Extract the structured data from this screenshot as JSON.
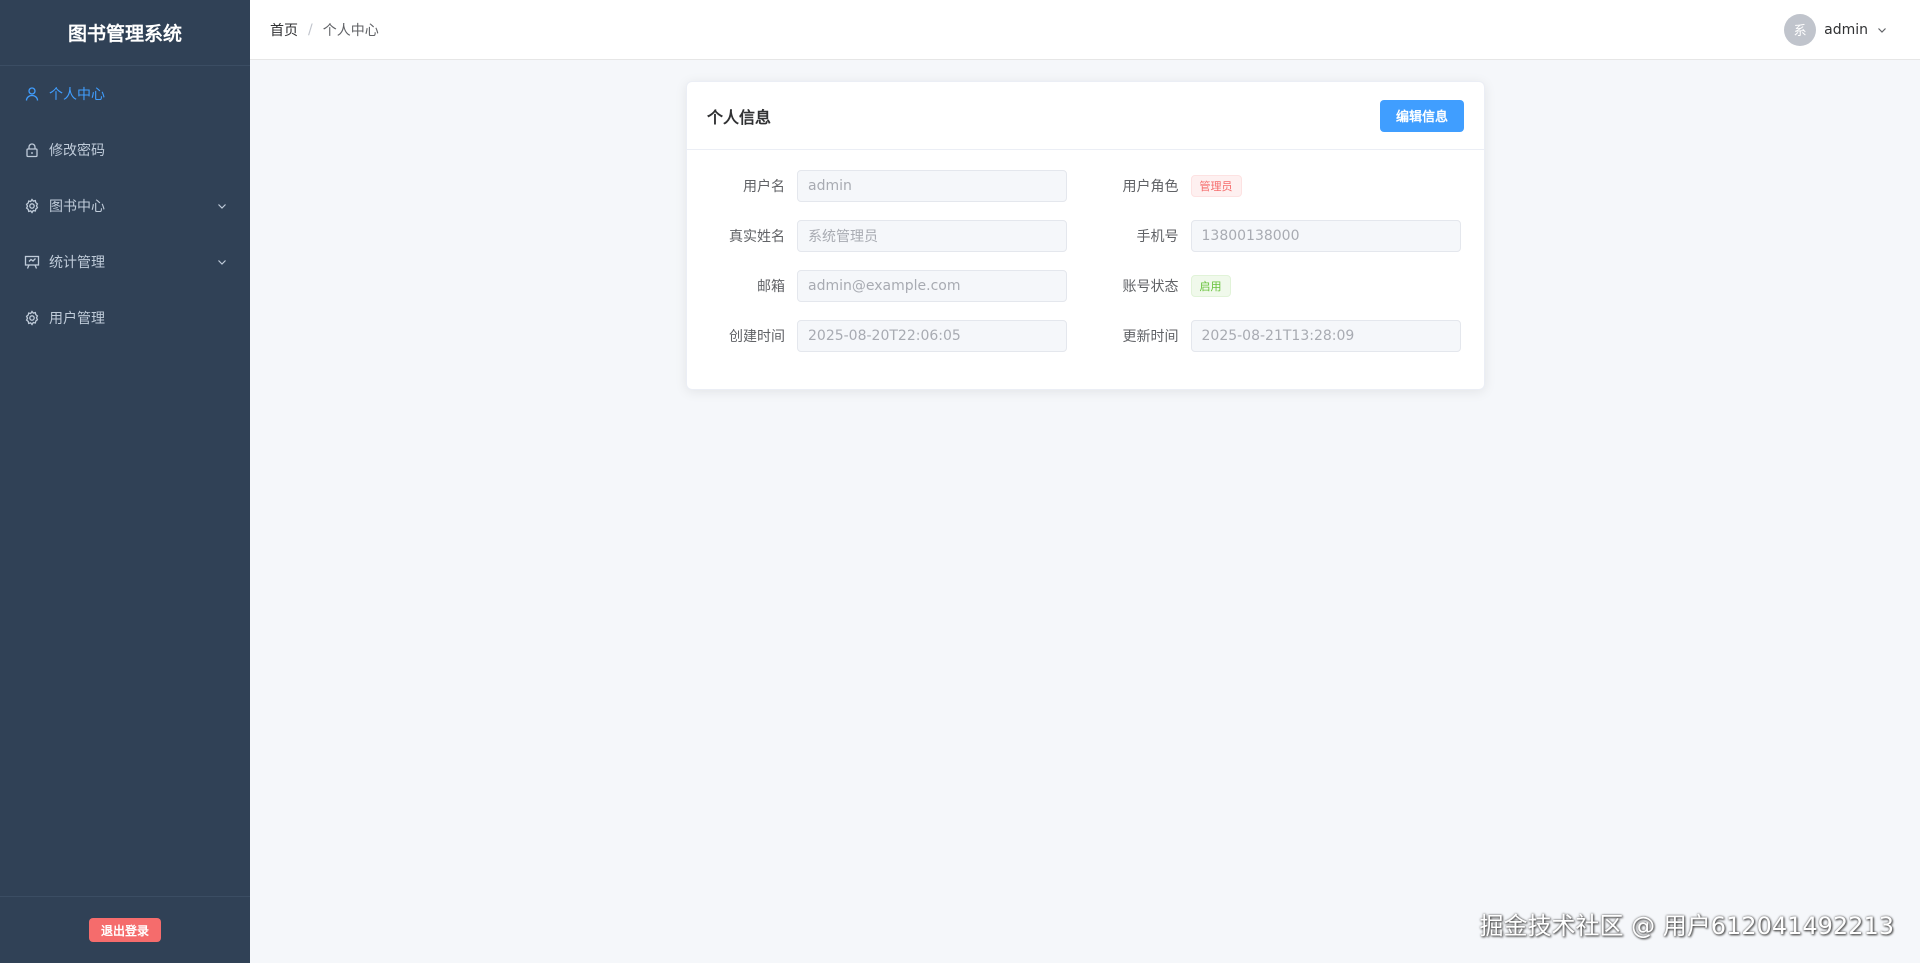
{
  "brand": {
    "title": "图书管理系统"
  },
  "sidebar": {
    "items": [
      {
        "label": "个人中心",
        "icon": "user-icon",
        "active": true,
        "expandable": false
      },
      {
        "label": "修改密码",
        "icon": "lock-icon",
        "active": false,
        "expandable": false
      },
      {
        "label": "图书中心",
        "icon": "gear-icon",
        "active": false,
        "expandable": true
      },
      {
        "label": "统计管理",
        "icon": "chart-board-icon",
        "active": false,
        "expandable": true
      },
      {
        "label": "用户管理",
        "icon": "gear-icon",
        "active": false,
        "expandable": false
      }
    ],
    "logout_label": "退出登录"
  },
  "header": {
    "breadcrumb": [
      "首页",
      "个人中心"
    ],
    "breadcrumb_separator": "/",
    "avatar_text": "系",
    "username": "admin"
  },
  "card": {
    "title": "个人信息",
    "edit_label": "编辑信息",
    "fields": {
      "username": {
        "label": "用户名",
        "value": "admin"
      },
      "role": {
        "label": "用户角色",
        "tag": "管理员"
      },
      "real_name": {
        "label": "真实姓名",
        "value": "系统管理员"
      },
      "phone": {
        "label": "手机号",
        "value": "13800138000"
      },
      "email": {
        "label": "邮箱",
        "value": "admin@example.com"
      },
      "status": {
        "label": "账号状态",
        "tag": "启用"
      },
      "created": {
        "label": "创建时间",
        "value": "2025-08-20T22:06:05"
      },
      "updated": {
        "label": "更新时间",
        "value": "2025-08-21T13:28:09"
      }
    }
  },
  "watermark": "掘金技术社区 @ 用户612041492213",
  "colors": {
    "sidebar_bg": "#304156",
    "accent": "#409eff",
    "danger": "#f56c6c",
    "success": "#67c23a"
  }
}
